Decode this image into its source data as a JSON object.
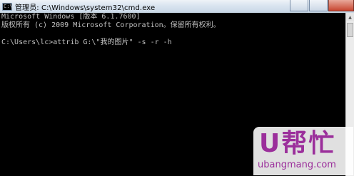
{
  "window": {
    "title": "管理员: C:\\Windows\\system32\\cmd.exe",
    "icon_text": "C:\\"
  },
  "console": {
    "lines": [
      "Microsoft Windows [版本 6.1.7600]",
      "版权所有 (c) 2009 Microsoft Corporation。保留所有权利。",
      "",
      "C:\\Users\\lc>attrib G:\\\"我的图片\" -s -r -h"
    ]
  },
  "scrollbar": {
    "up_arrow": "▲",
    "down_arrow": "▼"
  },
  "watermark": {
    "brand": "U帮忙",
    "url": "ubangmang.com"
  },
  "colors": {
    "console_bg": "#000000",
    "console_fg": "#c0c0c0",
    "watermark": "#9b2f9b"
  }
}
